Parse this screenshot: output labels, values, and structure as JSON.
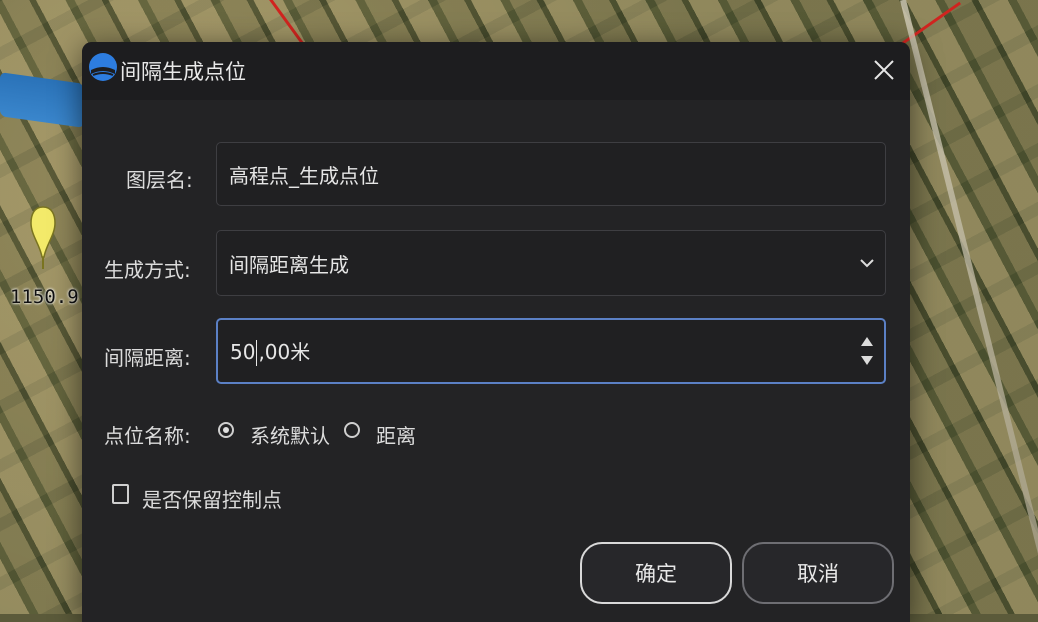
{
  "map": {
    "marker_label": "1150.9"
  },
  "dialog": {
    "title": "间隔生成点位",
    "icons": {
      "logo": "app-logo-icon",
      "close": "close-icon"
    },
    "layer_name": {
      "label": "图层名:",
      "value": "高程点_生成点位"
    },
    "generate_mode": {
      "label": "生成方式:",
      "selected": "间隔距离生成"
    },
    "interval": {
      "label": "间隔距离:",
      "value_before_caret": "50",
      "value_after_caret": ",00米"
    },
    "point_name": {
      "label": "点位名称:",
      "options": [
        {
          "label": "系统默认",
          "checked": true
        },
        {
          "label": "距离",
          "checked": false
        }
      ]
    },
    "keep_control_points": {
      "label": "是否保留控制点",
      "checked": false
    },
    "buttons": {
      "ok": "确定",
      "cancel": "取消"
    },
    "colors": {
      "background": "#232325",
      "focus_border": "#5b80c5"
    }
  }
}
